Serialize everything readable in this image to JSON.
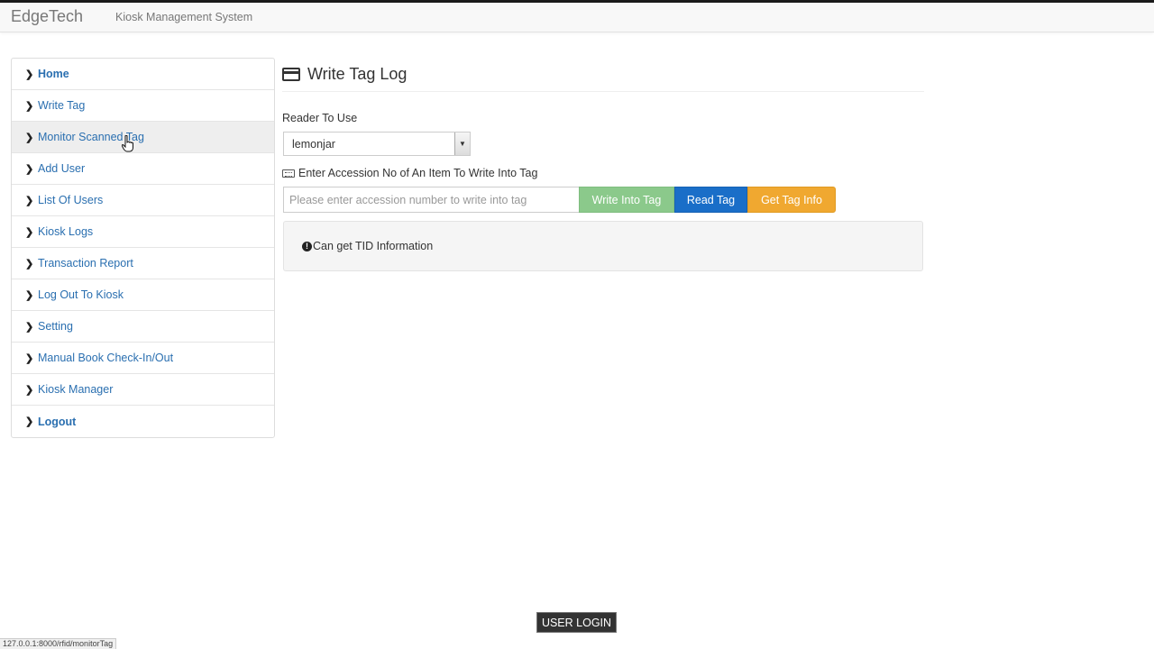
{
  "navbar": {
    "brand": "EdgeTech",
    "subtitle": "Kiosk Management System"
  },
  "sidebar": {
    "items": [
      {
        "label": "Home"
      },
      {
        "label": "Write Tag"
      },
      {
        "label": "Monitor Scanned Tag"
      },
      {
        "label": "Add User"
      },
      {
        "label": "List Of Users"
      },
      {
        "label": "Kiosk Logs"
      },
      {
        "label": "Transaction Report"
      },
      {
        "label": "Log Out To Kiosk"
      },
      {
        "label": "Setting"
      },
      {
        "label": "Manual Book Check-In/Out"
      },
      {
        "label": "Kiosk Manager"
      },
      {
        "label": "Logout"
      }
    ]
  },
  "main": {
    "title": "Write Tag Log",
    "reader_label": "Reader To Use",
    "reader_value": "lemonjar",
    "accession_label": "Enter Accession No of An Item To Write Into Tag",
    "accession_placeholder": "Please enter accession number to write into tag",
    "accession_value": "",
    "buttons": {
      "write": "Write Into Tag",
      "read": "Read Tag",
      "info": "Get Tag Info"
    },
    "info_message": "Can get TID Information"
  },
  "footer": {
    "user_login": "USER LOGIN"
  },
  "status_bar": {
    "url": "127.0.0.1:8000/rfid/monitorTag"
  },
  "colors": {
    "link": "#337ab7",
    "write_button": "#8bc98b",
    "read_button": "#1a6ec8",
    "info_button": "#f0a830"
  }
}
